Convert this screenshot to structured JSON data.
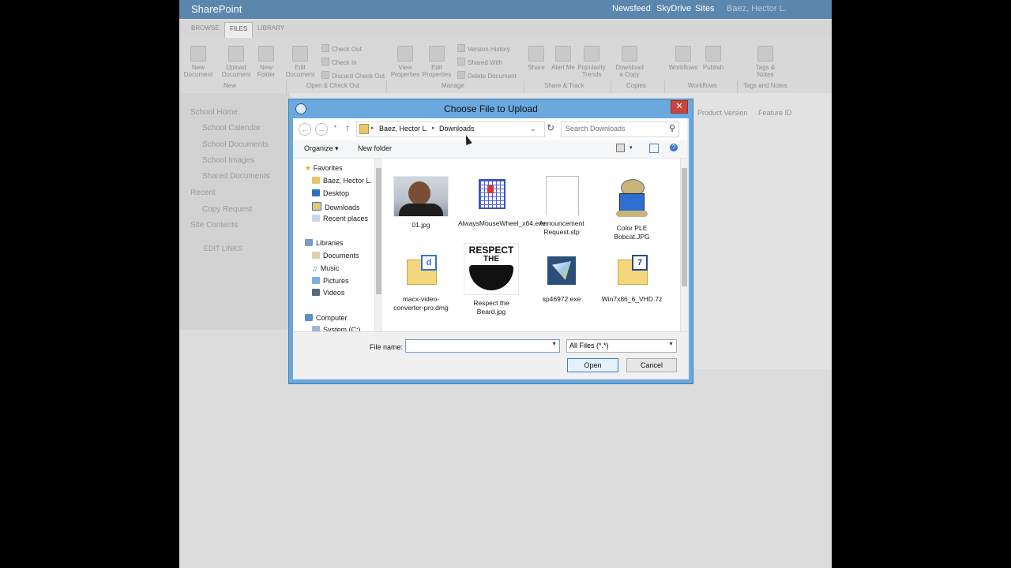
{
  "sharepoint": {
    "brand": "SharePoint",
    "nav": [
      "Newsfeed",
      "SkyDrive",
      "Sites"
    ],
    "user": "Baez, Hector L.",
    "ribbon_tabs": [
      "BROWSE",
      "FILES",
      "LIBRARY"
    ],
    "ribbon_buttons": {
      "new_document": "New Document",
      "upload_document": "Upload Document",
      "new_folder": "New Folder",
      "edit_document": "Edit Document",
      "check_out": "Check Out",
      "check_in": "Check In",
      "discard_check_out": "Discard Check Out",
      "view_properties": "View Properties",
      "edit_properties": "Edit Properties",
      "version_history": "Version History",
      "shared_with": "Shared With",
      "delete_document": "Delete Document",
      "share": "Share",
      "alert_me": "Alert Me",
      "popularity_trends": "Popularity Trends",
      "download_copy": "Download a Copy",
      "workflows": "Workflows",
      "publish": "Publish",
      "tags_notes": "Tags & Notes"
    },
    "ribbon_groups": [
      "New",
      "Open & Check Out",
      "Manage",
      "Share & Track",
      "Copies",
      "Workflows",
      "Tags and Notes"
    ],
    "left_nav": [
      "School Home",
      "School Calendar",
      "School Documents",
      "School Images",
      "Shared Documents",
      "Recent",
      "Copy Request",
      "Site Contents",
      "EDIT LINKS"
    ],
    "columns": [
      "Product Version",
      "Feature ID"
    ]
  },
  "dialog": {
    "title": "Choose File to Upload",
    "close": "✕",
    "breadcrumb": [
      "Baez, Hector L.",
      "Downloads"
    ],
    "search_placeholder": "Search Downloads",
    "organize": "Organize",
    "new_folder": "New folder",
    "tree": {
      "favorites": "Favorites",
      "fav_items": [
        "Baez, Hector L.",
        "Desktop",
        "Downloads",
        "Recent places"
      ],
      "libraries": "Libraries",
      "lib_items": [
        "Documents",
        "Music",
        "Pictures",
        "Videos"
      ],
      "computer": "Computer",
      "comp_items": [
        "System (C:)"
      ]
    },
    "files": [
      {
        "name": "01.jpg",
        "icon": "photo-thumbnail"
      },
      {
        "name": "AlwaysMouseWheel_x64.exe",
        "icon": "exe-icon"
      },
      {
        "name": "Announcement Request.stp",
        "icon": "blank-file-icon"
      },
      {
        "name": "Color PLE Bobcat.JPG",
        "icon": "bobcat-image"
      },
      {
        "name": "macx-video-converter-pro.dmg",
        "icon": "dmg-file-icon"
      },
      {
        "name": "Respect the Beard.jpg",
        "icon": "beard-image"
      },
      {
        "name": "sp46972.exe",
        "icon": "installer-icon"
      },
      {
        "name": "Win7x86_6_VHD.7z",
        "icon": "7z-file-icon"
      }
    ],
    "beard_text": [
      "RESPECT",
      "THE"
    ],
    "file_name_label": "File name:",
    "file_name_value": "",
    "filter": "All Files (*.*)",
    "open": "Open",
    "cancel": "Cancel"
  }
}
